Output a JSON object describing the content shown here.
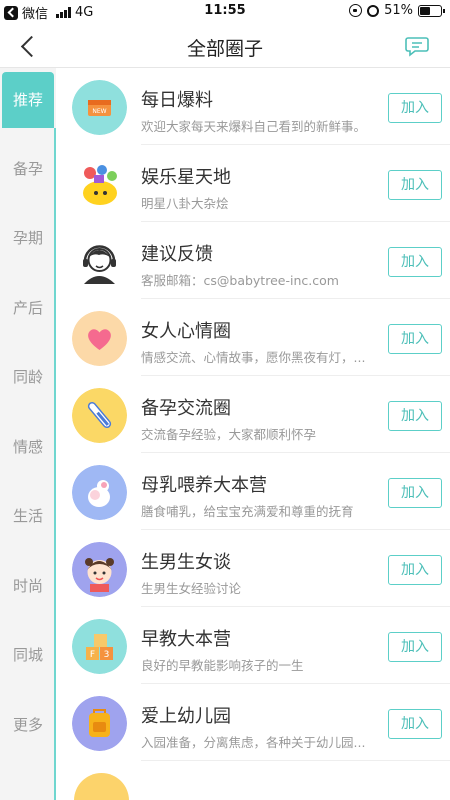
{
  "status_bar": {
    "carrier": "微信",
    "network": "4G",
    "time": "11:55",
    "battery": "51%",
    "battery_level": 0.51
  },
  "header": {
    "title": "全部圈子",
    "back_icon": "chevron-left-icon",
    "message_icon": "chat-bubble-icon"
  },
  "sidebar": {
    "active_color": "#5ccfc8",
    "items": [
      {
        "label": "推荐",
        "active": true
      },
      {
        "label": "备孕",
        "active": false
      },
      {
        "label": "孕期",
        "active": false
      },
      {
        "label": "产后",
        "active": false
      },
      {
        "label": "同龄",
        "active": false
      },
      {
        "label": "情感",
        "active": false
      },
      {
        "label": "生活",
        "active": false
      },
      {
        "label": "时尚",
        "active": false
      },
      {
        "label": "同城",
        "active": false
      },
      {
        "label": "更多",
        "active": false
      }
    ]
  },
  "circles": [
    {
      "name": "每日爆料",
      "desc": "欢迎大家每天来爆料自己看到的新鲜事。",
      "join": "加入",
      "icon": "news-icon",
      "color": "#8fe0dd"
    },
    {
      "name": "娱乐星天地",
      "desc": "明星八卦大杂烩",
      "join": "加入",
      "icon": "entertainment-icon",
      "color": "#ffffff"
    },
    {
      "name": "建议反馈",
      "desc": "客服邮箱：cs@babytree-inc.com",
      "join": "加入",
      "icon": "customer-service-icon",
      "color": "#ffffff"
    },
    {
      "name": "女人心情圈",
      "desc": "情感交流、心情故事，愿你黑夜有灯，...",
      "join": "加入",
      "icon": "heart-icon",
      "color": "#fcd9a8"
    },
    {
      "name": "备孕交流圈",
      "desc": "交流备孕经验，大家都顺利怀孕",
      "join": "加入",
      "icon": "thermometer-icon",
      "color": "#fbd866"
    },
    {
      "name": "母乳喂养大本营",
      "desc": "膳食哺乳，给宝宝充满爱和尊重的抚育",
      "join": "加入",
      "icon": "breastfeeding-icon",
      "color": "#9fb8f4"
    },
    {
      "name": "生男生女谈",
      "desc": "生男生女经验讨论",
      "join": "加入",
      "icon": "girl-icon",
      "color": "#9fa3ee"
    },
    {
      "name": "早教大本营",
      "desc": "良好的早教能影响孩子的一生",
      "join": "加入",
      "icon": "blocks-icon",
      "color": "#8fe0dd"
    },
    {
      "name": "爱上幼儿园",
      "desc": "入园准备，分离焦虑，各种关于幼儿园...",
      "join": "加入",
      "icon": "backpack-icon",
      "color": "#9fa3ee"
    }
  ]
}
